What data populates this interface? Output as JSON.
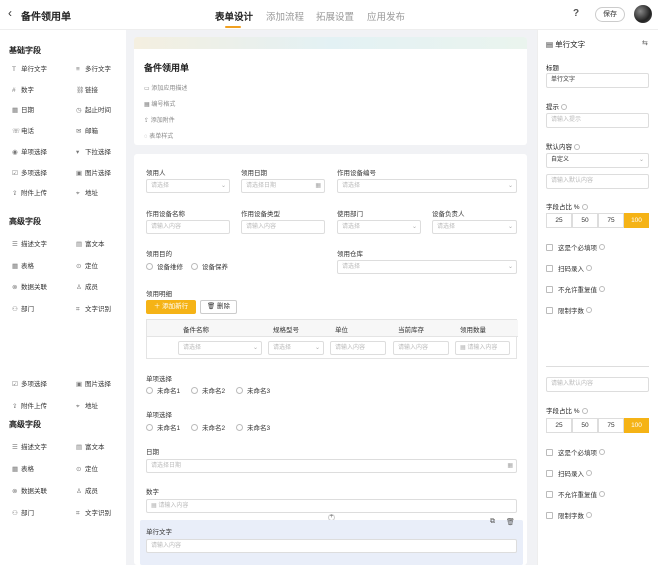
{
  "header": {
    "title": "备件领用单",
    "tabs": [
      "表单设计",
      "添加流程",
      "拓展设置",
      "应用发布"
    ],
    "help": "?",
    "save": "保存"
  },
  "sidebar": {
    "basic_title": "基础字段",
    "basic": [
      [
        "单行文字",
        "多行文字"
      ],
      [
        "数字",
        "链接"
      ],
      [
        "日期",
        "起止时间"
      ],
      [
        "电话",
        "邮箱"
      ],
      [
        "单项选择",
        "下拉选择"
      ],
      [
        "多项选择",
        "图片选择"
      ],
      [
        "附件上传",
        "地址"
      ]
    ],
    "advanced_title": "高级字段",
    "advanced": [
      [
        "描述文字",
        "富文本"
      ],
      [
        "表格",
        "定位"
      ],
      [
        "数据关联",
        "成员"
      ],
      [
        "部门",
        "文字识别"
      ]
    ],
    "basic2": [
      [
        "多项选择",
        "图片选择"
      ],
      [
        "附件上传",
        "地址"
      ]
    ],
    "advanced2_title": "高级字段",
    "advanced2": [
      [
        "描述文字",
        "富文本"
      ],
      [
        "表格",
        "定位"
      ],
      [
        "数据关联",
        "成员"
      ],
      [
        "部门",
        "文字识别"
      ]
    ]
  },
  "form_header": {
    "title": "备件领用单",
    "links": [
      "添加应用描述",
      "编号格式",
      "添加附件",
      "表单样式"
    ]
  },
  "fields": {
    "row1": [
      {
        "label": "领用人",
        "ph": "请选择"
      },
      {
        "label": "领用日期",
        "ph": "请选择日期"
      },
      {
        "label": "作用设备编号",
        "ph": "请选择"
      }
    ],
    "row2": [
      {
        "label": "作用设备名称",
        "ph": "请输入内容"
      },
      {
        "label": "作用设备类型",
        "ph": "请输入内容"
      },
      {
        "label": "使用部门",
        "ph": "请选择"
      },
      {
        "label": "设备负责人",
        "ph": "请选择"
      }
    ],
    "purpose_label": "领用目的",
    "purpose_opts": [
      "设备维修",
      "设备保养"
    ],
    "warehouse_label": "领用仓库",
    "warehouse_ph": "请选择",
    "detail_label": "领用明细",
    "add_row": "添加新行",
    "delete": "删除",
    "table_headers": [
      "备件名称",
      "规格型号",
      "单位",
      "当前库存",
      "领用数量"
    ],
    "table_ph": [
      "请选择",
      "请选择",
      "请输入内容",
      "请输入内容",
      "请输入内容"
    ],
    "single1_label": "单项选择",
    "single1_opts": [
      "未命名1",
      "未命名2",
      "未命名3"
    ],
    "single2_label": "单项选择",
    "single2_opts": [
      "未命名1",
      "未命名2",
      "未命名3"
    ],
    "date_label": "日期",
    "date_ph": "请选择日期",
    "number_label": "数字",
    "number_ph": "请输入内容",
    "text_label": "单行文字",
    "text_ph": "请输入内容"
  },
  "panel": {
    "title": "单行文字",
    "title_label": "标题",
    "title_value": "单行文字",
    "hint_label": "提示",
    "hint_ph": "请输入提示",
    "default_label": "默认内容",
    "default_value": "自定义",
    "default_ph": "请输入默认内容",
    "width_label": "字段占比 %",
    "widths": [
      "25",
      "50",
      "75",
      "100"
    ],
    "checks": [
      "这是个必填项",
      "扫码录入",
      "不允许重复值",
      "限制字数"
    ],
    "default_ph2": "请输入默认内容",
    "width_label2": "字段占比 %",
    "widths2": [
      "25",
      "50",
      "75",
      "100"
    ],
    "checks2": [
      "这是个必填项",
      "扫码录入",
      "不允许重复值",
      "限制字数"
    ]
  },
  "colors": {
    "accent": "#f5b316"
  }
}
